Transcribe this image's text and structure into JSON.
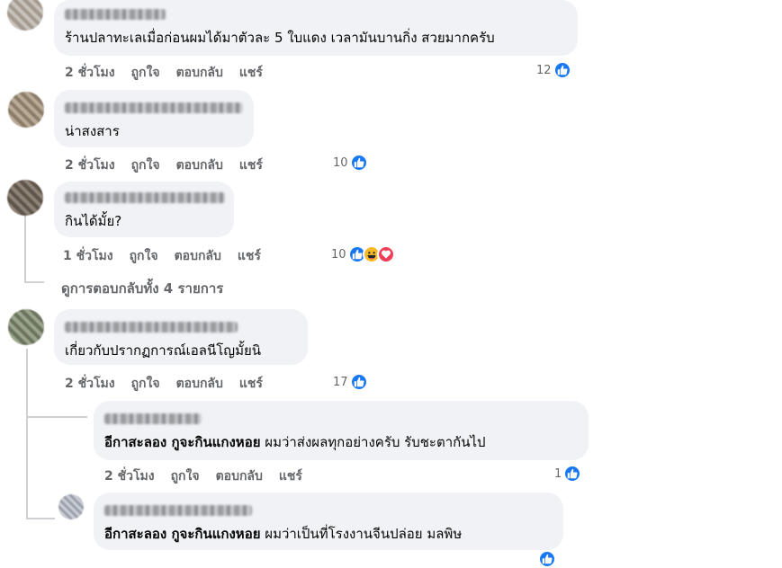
{
  "comments": [
    {
      "text": "ร้านปลาทะเลเมื่อก่อนผมได้มาตัวละ 5 ใบแดง เวลามันบานกิ่ง สวยมากครับ",
      "time": "2 ชั่วโมง",
      "like": "ถูกใจ",
      "reply": "ตอบกลับ",
      "share": "แชร์",
      "reaction_count": "12",
      "reactions": [
        "like-icon"
      ]
    },
    {
      "text": "น่าสงสาร",
      "time": "2 ชั่วโมง",
      "like": "ถูกใจ",
      "reply": "ตอบกลับ",
      "share": "แชร์",
      "reaction_count": "10",
      "reactions": [
        "like-icon"
      ]
    },
    {
      "text": "กินได้มั้ย?",
      "time": "1 ชั่วโมง",
      "like": "ถูกใจ",
      "reply": "ตอบกลับ",
      "share": "แชร์",
      "reaction_count": "10",
      "reactions": [
        "like-icon",
        "haha-icon",
        "love-icon"
      ]
    },
    {
      "text": "เกี่ยวกับปรากฏการณ์เอลนีโญมั้ยนิ",
      "time": "2 ชั่วโมง",
      "like": "ถูกใจ",
      "reply": "ตอบกลับ",
      "share": "แชร์",
      "reaction_count": "17",
      "reactions": [
        "like-icon"
      ]
    }
  ],
  "view_replies": "ดูการตอบกลับทั้ง 4 รายการ",
  "replies": [
    {
      "mention": "อีกาสะลอง กูจะกินแกงหอย",
      "text": "ผมว่าส่งผลทุกอย่างครับ รับชะตากันไป",
      "time": "2 ชั่วโมง",
      "like": "ถูกใจ",
      "reply": "ตอบกลับ",
      "share": "แชร์",
      "reaction_count": "1",
      "reactions": [
        "like-icon"
      ]
    },
    {
      "mention": "อีกาสะลอง กูจะกินแกงหอย",
      "text": "ผมว่าเป็นที่โรงงานจีนปล่อย มลพิษ",
      "reactions": [
        "like-icon"
      ]
    }
  ],
  "colors": {
    "bubble": "#f0f2f5",
    "action_text": "#65676b",
    "like_blue": "#1877f2",
    "haha_yellow": "#f7b928",
    "love_red": "#f33e58",
    "thread_line": "#ced0d4"
  }
}
